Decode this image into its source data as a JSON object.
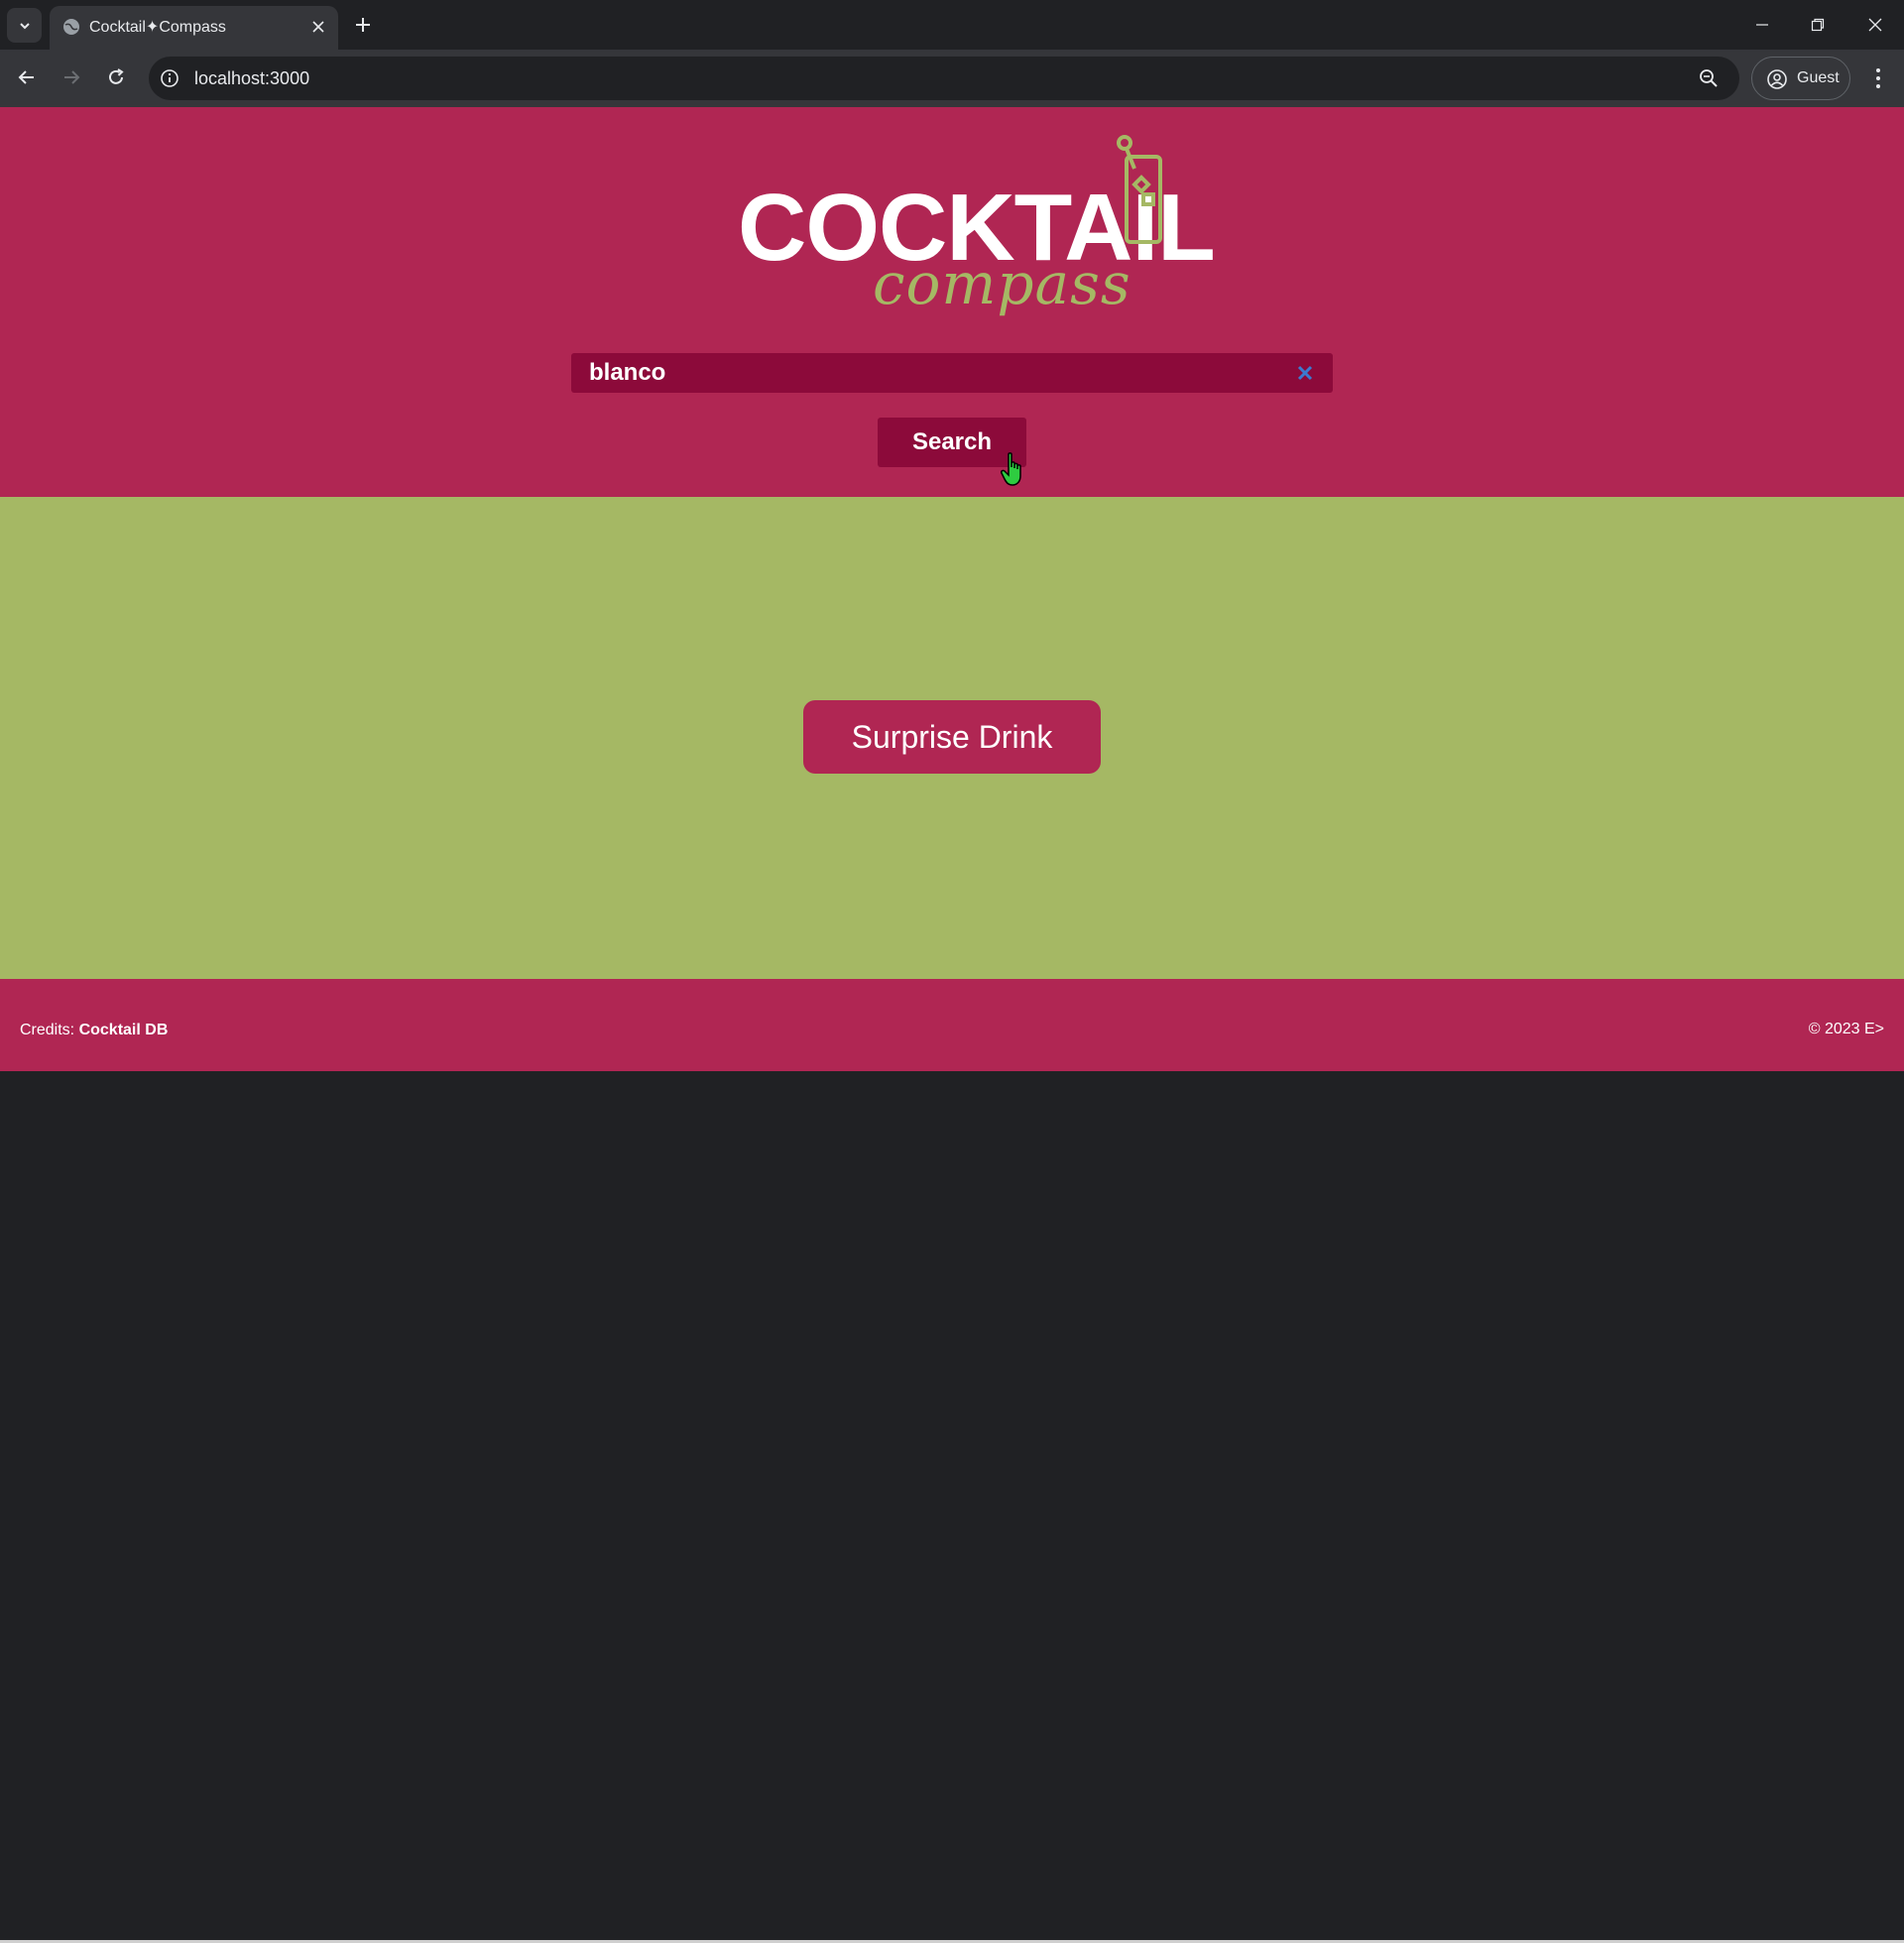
{
  "browser": {
    "tab_title": "Cocktail✦Compass",
    "url": "localhost:3000",
    "profile_label": "Guest",
    "icons": [
      "tab-list-icon",
      "globe-icon",
      "close-icon",
      "plus-icon",
      "minimize-icon",
      "restore-icon",
      "window-close-icon",
      "back-icon",
      "forward-icon",
      "reload-icon",
      "info-icon",
      "zoom-icon",
      "profile-icon",
      "kebab-menu-icon"
    ]
  },
  "header": {
    "logo_word": "COCKTAIL",
    "logo_script": "compass"
  },
  "search": {
    "value": "blanco",
    "button_label": "Search"
  },
  "main": {
    "surprise_label": "Surprise Drink"
  },
  "footer": {
    "credits_prefix": "Credits: ",
    "credits_source": "Cocktail DB",
    "copyright": "© 2023 E>"
  },
  "colors": {
    "brand_crimson": "#b02653",
    "dark_crimson": "#8c0a3a",
    "olive_green": "#a5b864",
    "white": "#ffffff"
  }
}
